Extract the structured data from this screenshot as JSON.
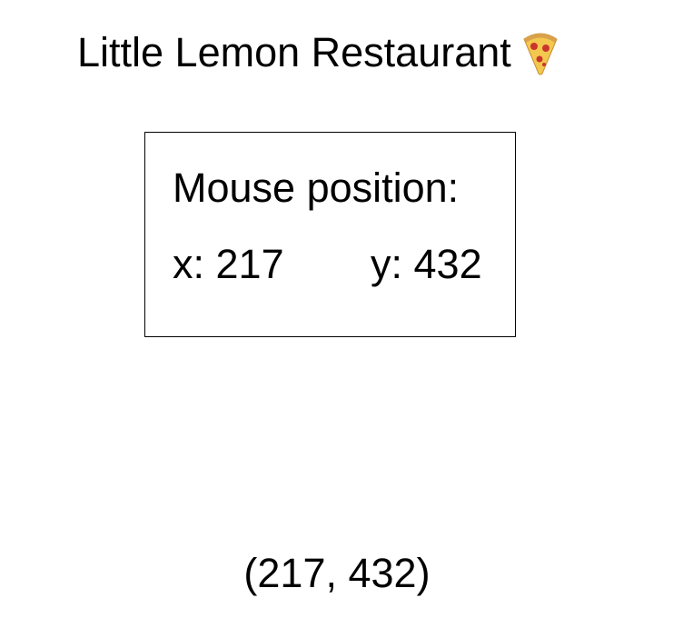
{
  "header": {
    "title": "Little Lemon Restaurant",
    "icon": "pizza-icon"
  },
  "mouse_panel": {
    "heading": "Mouse position:",
    "x_label": "x:",
    "x_value": "217",
    "y_label": "y:",
    "y_value": "432"
  },
  "cursor_readout": {
    "text": "(217, 432)"
  },
  "colors": {
    "text": "#000000",
    "border": "#000000",
    "background": "#ffffff",
    "pizza_crust": "#d9a24a",
    "pizza_cheese": "#f3c84f",
    "pizza_pepperoni": "#c9362b"
  }
}
